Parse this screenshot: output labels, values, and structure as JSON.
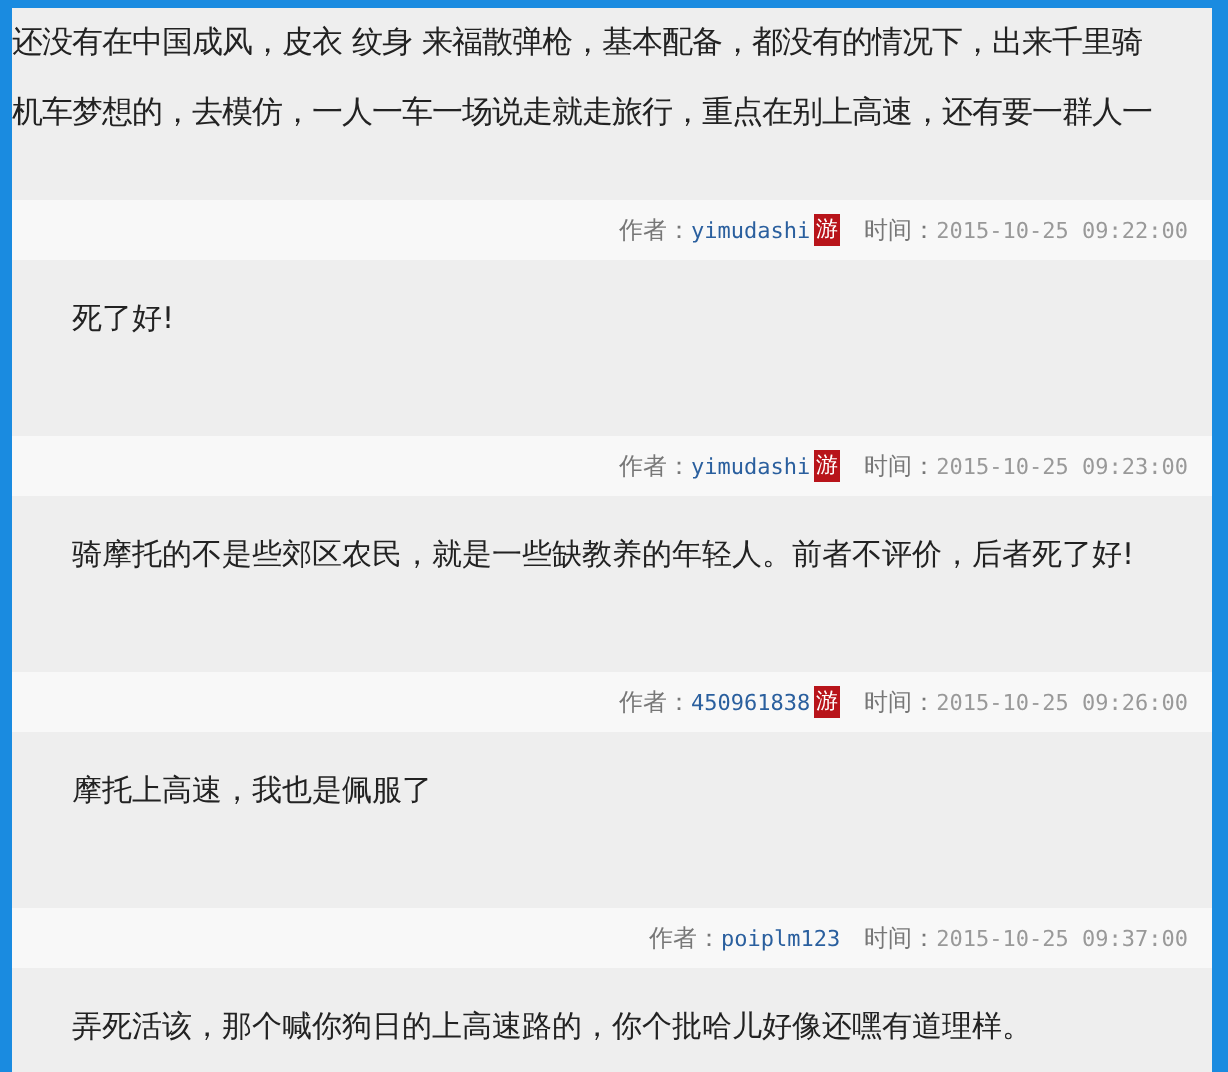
{
  "intro": {
    "lines": [
      "还没有在中国成风，皮衣 纹身 来福散弹枪，基本配备，都没有的情况下，出来千里骑",
      "机车梦想的，去模仿，一人一车一场说走就走旅行，重点在别上高速，还有要一群人一"
    ]
  },
  "replies": [
    {
      "author_label": "作者：",
      "author": "yimudashi",
      "badge": "游",
      "time_label": "时间：",
      "time": "2015-10-25 09:22:00",
      "text": "死了好!"
    },
    {
      "author_label": "作者：",
      "author": "yimudashi",
      "badge": "游",
      "time_label": "时间：",
      "time": "2015-10-25 09:23:00",
      "text": "骑摩托的不是些郊区农民，就是一些缺教养的年轻人。前者不评价，后者死了好!"
    },
    {
      "author_label": "作者：",
      "author": "450961838",
      "badge": "游",
      "time_label": "时间：",
      "time": "2015-10-25 09:26:00",
      "text": "摩托上高速，我也是佩服了"
    },
    {
      "author_label": "作者：",
      "author": "poiplm123",
      "time_label": "时间：",
      "time": "2015-10-25 09:37:00",
      "text": "弄死活该，那个喊你狗日的上高速路的，你个批哈儿好像还嘿有道理样。"
    }
  ]
}
